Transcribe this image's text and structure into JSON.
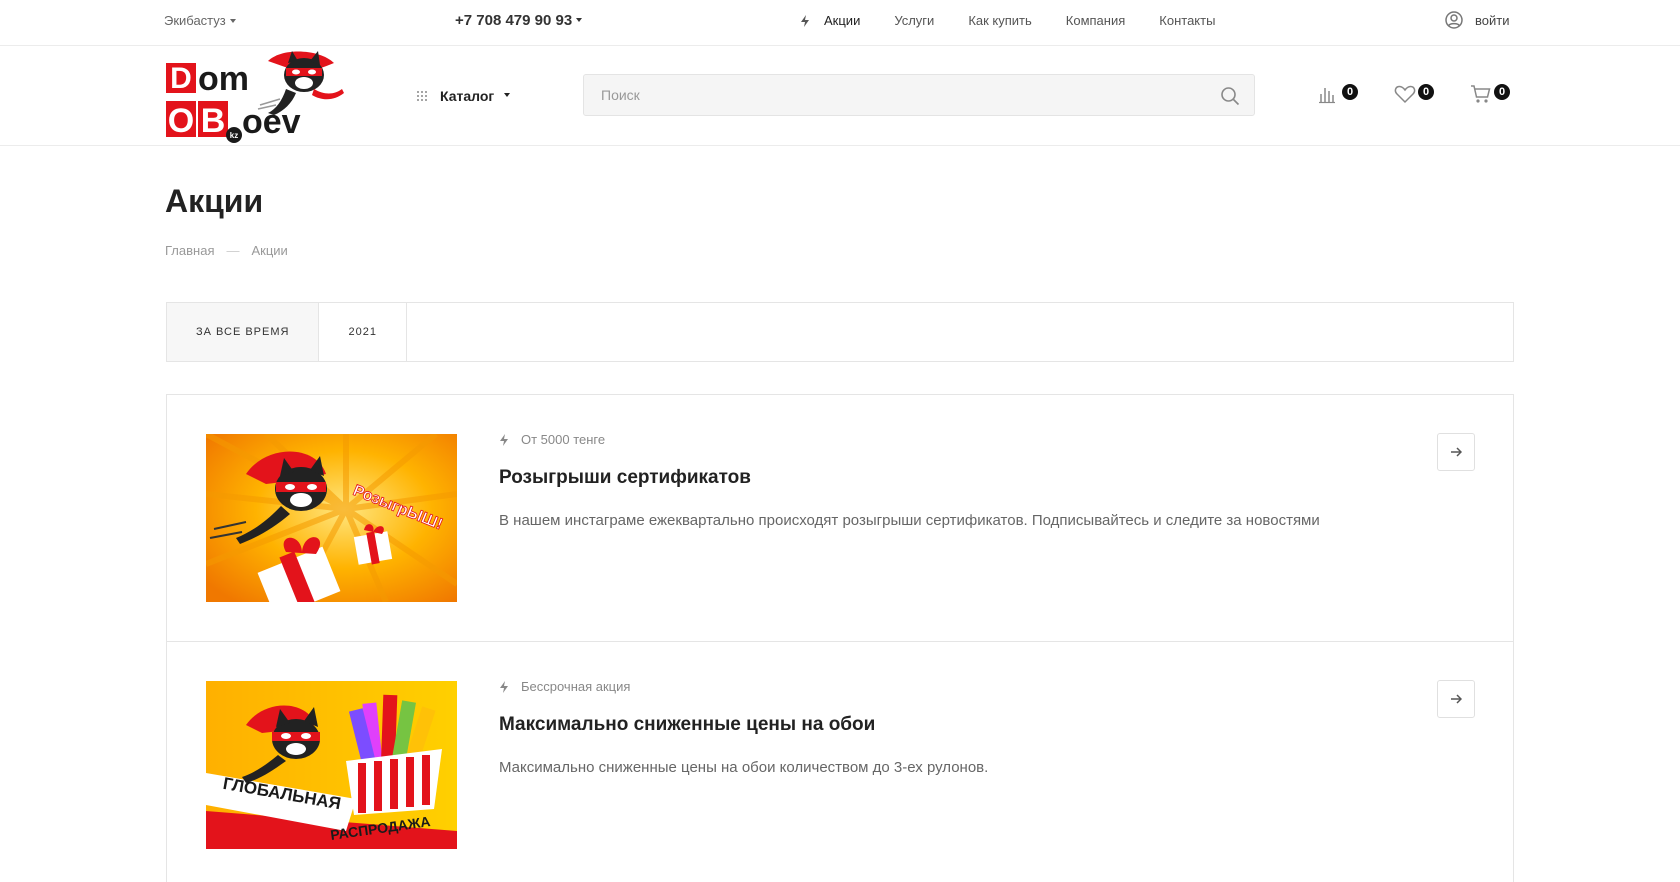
{
  "topbar": {
    "city": "Экибастуз",
    "phone": "+7 708 479 90 93",
    "nav": [
      {
        "label": "Акции",
        "active": true
      },
      {
        "label": "Услуги"
      },
      {
        "label": "Как купить"
      },
      {
        "label": "Компания"
      },
      {
        "label": "Контакты"
      }
    ],
    "login_label": "войти"
  },
  "header": {
    "logo": {
      "line1": "Dom",
      "line2": "OB",
      "line2_tail": "oev",
      "tld": "kz"
    },
    "catalog_label": "Каталог",
    "search_placeholder": "Поиск",
    "compare_count": "0",
    "favorites_count": "0",
    "cart_count": "0"
  },
  "page": {
    "title": "Акции",
    "breadcrumbs": {
      "home": "Главная",
      "separator": "—",
      "current": "Акции"
    },
    "filters": [
      {
        "label": "ЗА ВСЕ ВРЕМЯ",
        "active": true
      },
      {
        "label": "2021"
      }
    ]
  },
  "promos": [
    {
      "period": "От 5000 тенге",
      "title": "Розыгрыши сертификатов",
      "description": "В нашем инстаграме ежеквартально происходят розыгрыши сертификатов. Подписывайтесь и следите за новостями",
      "image_caption": "РозыгрЫШ!"
    },
    {
      "period": "Бессрочная акция",
      "title": "Максимально сниженные цены на обои",
      "description": "Максимально сниженные цены на обои количеством до 3-ех рулонов.",
      "image_caption_1": "ГЛОБАЛЬНАЯ",
      "image_caption_2": "РАСПРОДАЖА"
    }
  ],
  "colors": {
    "brand_red": "#e3131b",
    "accent_orange": "#f7a400",
    "badge": "#111111"
  }
}
